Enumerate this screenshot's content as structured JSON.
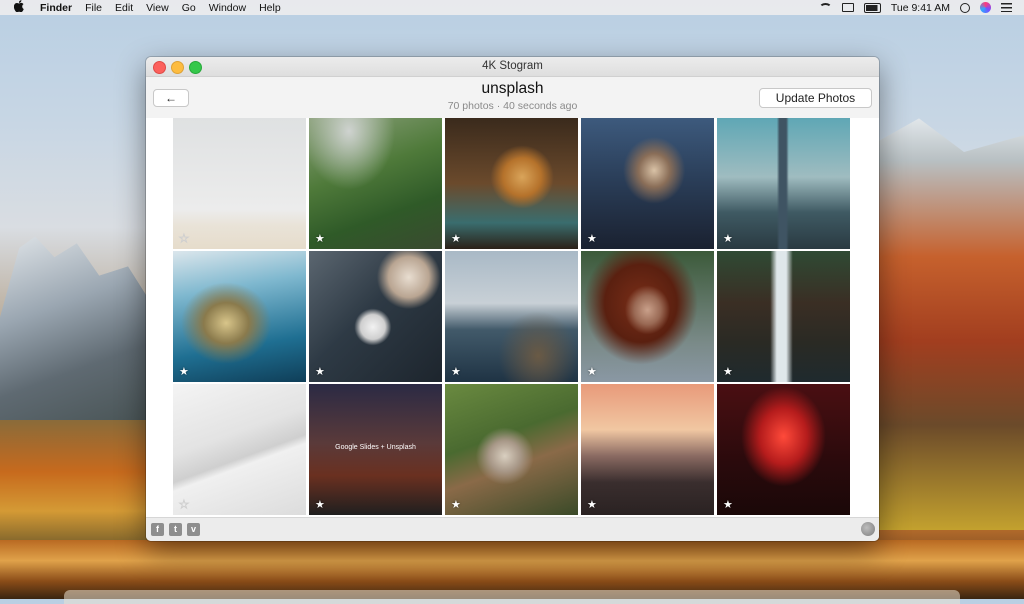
{
  "menubar": {
    "apple": "",
    "app": "Finder",
    "items": [
      "File",
      "Edit",
      "View",
      "Go",
      "Window",
      "Help"
    ],
    "clock": "Tue 9:41 AM"
  },
  "window": {
    "title": "4K Stogram",
    "back_label": "←",
    "account": "unsplash",
    "subtitle": "70 photos · 40 seconds ago",
    "update_label": "Update Photos"
  },
  "photos": [
    {
      "star": "★",
      "caption": ""
    },
    {
      "star": "★",
      "caption": ""
    },
    {
      "star": "★",
      "caption": ""
    },
    {
      "star": "★",
      "caption": ""
    },
    {
      "star": "★",
      "caption": ""
    },
    {
      "star": "★",
      "caption": ""
    },
    {
      "star": "★",
      "caption": ""
    },
    {
      "star": "★",
      "caption": ""
    },
    {
      "star": "★",
      "caption": ""
    },
    {
      "star": "★",
      "caption": ""
    },
    {
      "star": "★",
      "caption": ""
    },
    {
      "star": "★",
      "caption": "Google Slides + Unsplash"
    },
    {
      "star": "★",
      "caption": ""
    },
    {
      "star": "★",
      "caption": ""
    },
    {
      "star": "★",
      "caption": ""
    }
  ],
  "footer": {
    "facebook": "f",
    "twitter": "t",
    "vimeo": "v"
  },
  "colors": {
    "close": "#fc605c",
    "minimize": "#fdbc40",
    "maximize": "#34c84a"
  }
}
